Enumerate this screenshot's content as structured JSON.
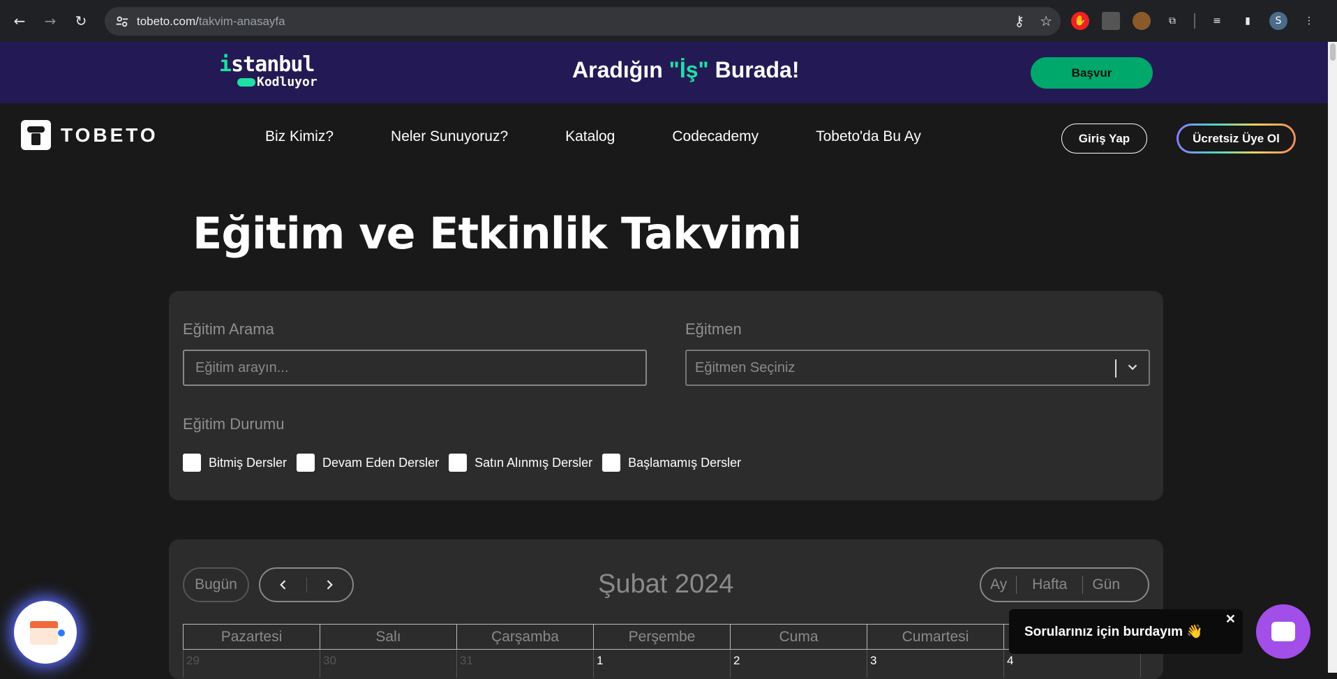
{
  "browser": {
    "url_host": "tobeto.com/",
    "url_path": "takvim-anasayfa",
    "avatar_initial": "S"
  },
  "promo": {
    "logo_line1_prefix": "i",
    "logo_line1_rest": "stanbul",
    "logo_line2": "Kodluyor",
    "headline_a": "Aradığın ",
    "headline_q": "\"İş\"",
    "headline_b": " Burada!",
    "apply_label": "Başvur",
    "accent_color": "#1fe0a5"
  },
  "nav": {
    "brand": "TOBETO",
    "items": [
      "Biz Kimiz?",
      "Neler Sunuyoruz?",
      "Katalog",
      "Codecademy",
      "Tobeto'da Bu Ay"
    ],
    "login_label": "Giriş Yap",
    "signup_label": "Ücretsiz Üye Ol"
  },
  "page": {
    "title": "Eğitim ve Etkinlik Takvimi"
  },
  "filters": {
    "search_label": "Eğitim Arama",
    "search_placeholder": "Eğitim arayın...",
    "instructor_label": "Eğitmen",
    "instructor_placeholder": "Eğitmen Seçiniz",
    "status_label": "Eğitim Durumu",
    "statuses": [
      "Bitmiş Dersler",
      "Devam Eden Dersler",
      "Satın Alınmış Dersler",
      "Başlamamış Dersler"
    ]
  },
  "calendar": {
    "today_label": "Bugün",
    "month_title": "Şubat 2024",
    "views": [
      "Ay",
      "Hafta",
      "Gün"
    ],
    "weekdays": [
      "Pazartesi",
      "Salı",
      "Çarşamba",
      "Perşembe",
      "Cuma",
      "Cumartesi",
      ""
    ],
    "first_row": [
      "29",
      "30",
      "31",
      "1",
      "2",
      "3",
      "4"
    ]
  },
  "chat": {
    "bubble_text": "Sorularınız için burdayım 👋",
    "close_label": "✕",
    "fab_color": "#a24ee8"
  }
}
